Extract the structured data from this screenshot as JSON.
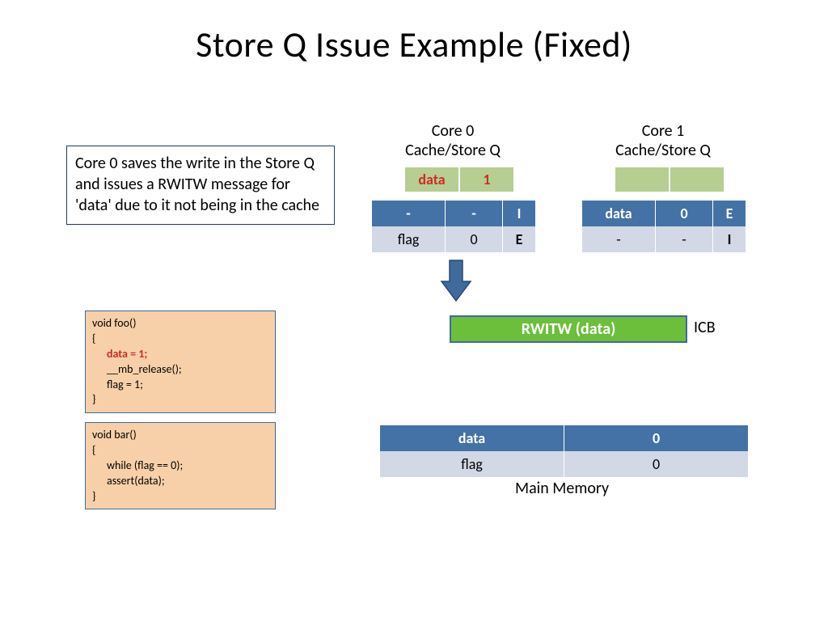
{
  "title": "Store Q Issue Example (Fixed)",
  "explanation": "Core 0 saves the write in the Store Q and issues a RWITW message for 'data' due to it not being in the cache",
  "core0": {
    "label_line1": "Core 0",
    "label_line2": "Cache/Store Q",
    "storeq": {
      "key": "data",
      "value": "1"
    },
    "cache": [
      {
        "addr": "-",
        "val": "-",
        "state": "I",
        "style": "hdr"
      },
      {
        "addr": "flag",
        "val": "0",
        "state": "E",
        "style": "alt"
      }
    ]
  },
  "core1": {
    "label_line1": "Core 1",
    "label_line2": "Cache/Store Q",
    "storeq": {
      "key": "",
      "value": ""
    },
    "cache": [
      {
        "addr": "data",
        "val": "0",
        "state": "E",
        "style": "hdr"
      },
      {
        "addr": "-",
        "val": "-",
        "state": "I",
        "style": "alt"
      }
    ]
  },
  "rwitw": {
    "label": "RWITW (data)",
    "side": "ICB"
  },
  "memory": {
    "rows": [
      {
        "addr": "data",
        "val": "0",
        "style": "hdr"
      },
      {
        "addr": "flag",
        "val": "0",
        "style": "alt"
      }
    ],
    "label": "Main Memory"
  },
  "code_foo": {
    "sig": "void foo()",
    "open": "{",
    "l1": "data = 1;",
    "l2": "__mb_release();",
    "l3": "flag = 1;",
    "close": "}"
  },
  "code_bar": {
    "sig": "void bar()",
    "open": "{",
    "l1": "while (flag == 0);",
    "l2": "assert(data);",
    "close": "}"
  }
}
